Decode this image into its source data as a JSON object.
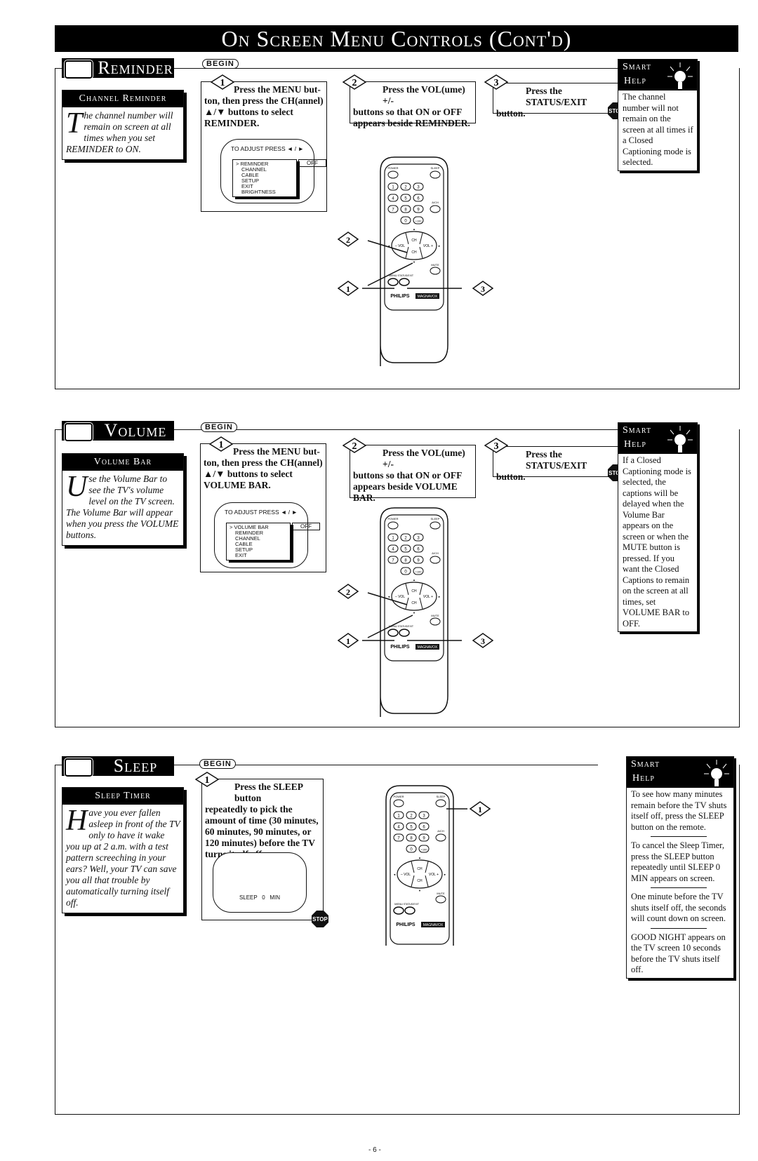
{
  "page": {
    "banner_title": "On Screen Menu Controls (Cont'd)",
    "page_number": "- 6 -",
    "begin_label": "BEGIN",
    "stop_label": "STOP"
  },
  "sections": [
    {
      "title": "Reminder",
      "intro": {
        "heading": "Channel Reminder",
        "drop_cap": "T",
        "text": "he channel number will remain on screen at all times when you set REMINDER to ON."
      },
      "steps": [
        {
          "number": "1",
          "first_line": "Press the MENU but-",
          "rest": "ton, then press the CH(annel) ▲/▼ buttons to select REMINDER."
        },
        {
          "number": "2",
          "first_line": "Press the VOL(ume) +/-",
          "rest": "buttons so that ON or OFF appears beside REMINDER."
        },
        {
          "number": "3",
          "first_line": "Press the STATUS/EXIT",
          "rest": "button."
        }
      ],
      "osd": {
        "header": "TO ADJUST PRESS ◄ / ►",
        "menu_items": [
          "> REMINDER",
          "CHANNEL",
          "CABLE",
          "SETUP",
          "EXIT",
          "BRIGHTNESS"
        ],
        "value": "OFF"
      },
      "smart_help": {
        "title_line1": "Smart",
        "title_line2": "Help",
        "paragraphs": [
          "The channel number will not remain on the screen at all times if a Closed Captioning mode is selected."
        ]
      }
    },
    {
      "title": "Volume",
      "intro": {
        "heading": "Volume Bar",
        "drop_cap": "U",
        "text": "se the Volume Bar to see the TV's volume level on the TV screen. The Volume Bar will appear when you press the VOLUME buttons."
      },
      "steps": [
        {
          "number": "1",
          "first_line": "Press the MENU but-",
          "rest": "ton, then press the CH(annel) ▲/▼ buttons to select VOLUME BAR."
        },
        {
          "number": "2",
          "first_line": "Press the VOL(ume) +/-",
          "rest": "buttons so that ON or OFF appears beside VOLUME BAR."
        },
        {
          "number": "3",
          "first_line": "Press the STATUS/EXIT",
          "rest": "button."
        }
      ],
      "osd": {
        "header": "TO ADJUST PRESS ◄ / ►",
        "menu_items": [
          "> VOLUME BAR",
          "REMINDER",
          "CHANNEL",
          "CABLE",
          "SETUP",
          "EXIT"
        ],
        "value": "OFF"
      },
      "smart_help": {
        "title_line1": "Smart",
        "title_line2": "Help",
        "paragraphs": [
          "If a Closed Captioning mode is selected, the captions will be delayed when the Volume Bar appears on the screen or when the MUTE button is pressed. If you want the Closed Captions to remain on the screen at all times, set VOLUME BAR to OFF."
        ]
      }
    },
    {
      "title": "Sleep",
      "intro": {
        "heading": "Sleep Timer",
        "drop_cap": "H",
        "text": "ave you ever fallen asleep in front of the TV only to have it wake you up at 2 a.m. with a test pattern screeching in your ears? Well, your TV can save you all that trouble by automatically turning itself off."
      },
      "steps": [
        {
          "number": "1",
          "first_line": "Press the SLEEP button",
          "rest": "repeatedly to pick the amount of time (30 minutes, 60 minutes, 90 minutes, or 120 minutes) before the TV turns itself off."
        }
      ],
      "osd": {
        "value": "SLEEP   0   MIN"
      },
      "smart_help": {
        "title_line1": "Smart",
        "title_line2": "Help",
        "paragraphs": [
          "To see how many minutes remain before the TV shuts itself off, press the SLEEP button on the remote.",
          "To cancel the Sleep Timer, press the SLEEP button repeatedly until SLEEP 0 MIN appears on screen.",
          "One minute before the TV shuts itself off, the seconds will count down on screen.",
          "GOOD NIGHT appears on the TV screen 10 seconds before the TV shuts itself off."
        ]
      }
    }
  ],
  "remote": {
    "brand": "PHILIPS",
    "sub_brand": "MAGNAVOX",
    "labels": {
      "power": "POWER",
      "sleep": "SLEEP",
      "alt_ch": "A/CH",
      "mute": "MUTE",
      "menu": "MENU",
      "status_exit": "STATUS/EXIT",
      "ch": "CH",
      "vol_minus": "– VOL",
      "vol_plus": "VOL +"
    },
    "number_keys": [
      "1",
      "2",
      "3",
      "4",
      "5",
      "6",
      "7",
      "8",
      "9",
      "0",
      "+100"
    ]
  }
}
